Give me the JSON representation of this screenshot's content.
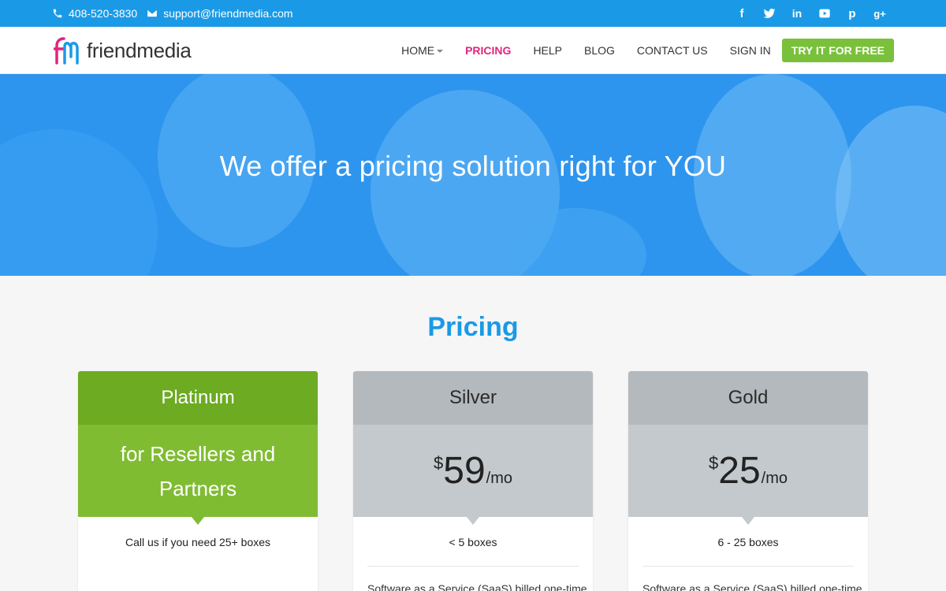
{
  "topbar": {
    "phone": "408-520-3830",
    "email": "support@friendmedia.com",
    "socials": [
      "facebook-icon",
      "twitter-icon",
      "linkedin-icon",
      "youtube-icon",
      "pinterest-icon",
      "google-plus-icon"
    ]
  },
  "nav": {
    "logo_text": "friendmedia",
    "items": [
      {
        "label": "HOME"
      },
      {
        "label": "PRICING"
      },
      {
        "label": "HELP"
      },
      {
        "label": "BLOG"
      },
      {
        "label": "CONTACT US"
      },
      {
        "label": "SIGN IN"
      }
    ],
    "cta": "TRY IT FOR FREE"
  },
  "hero": {
    "title": "We offer a pricing solution right for YOU"
  },
  "pricing": {
    "heading": "Pricing",
    "plans": [
      {
        "name": "Platinum",
        "tagline": "for Resellers and Partners",
        "boxes": "Call us if you need 25+ boxes"
      },
      {
        "name": "Silver",
        "currency": "$",
        "amount": "59",
        "period": "/mo",
        "boxes": "< 5 boxes",
        "desc": "Software as a Service (SaaS) billed one-time"
      },
      {
        "name": "Gold",
        "currency": "$",
        "amount": "25",
        "period": "/mo",
        "boxes": "6 - 25 boxes",
        "desc": "Software as a Service (SaaS) billed one-time"
      }
    ]
  },
  "colors": {
    "brand_blue": "#1a9ae6",
    "accent_pink": "#e0257d",
    "cta_green": "#79c13a",
    "platinum_green": "#6cab22",
    "gray_card": "#b4b9bd"
  }
}
